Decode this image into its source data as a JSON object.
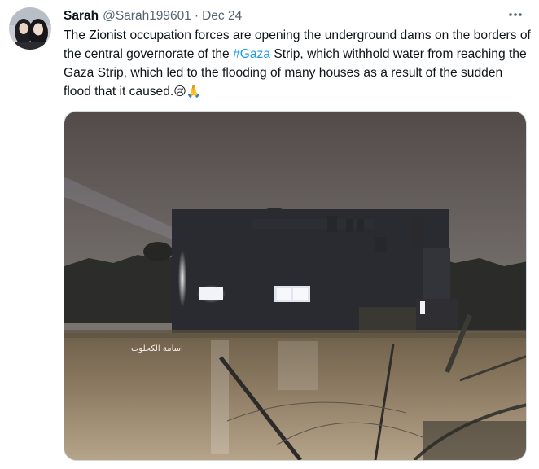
{
  "tweet": {
    "author_name": "Sarah",
    "author_handle": "@Sarah199601",
    "separator": "·",
    "date": "Dec 24",
    "more_glyph": "•••",
    "text_part1": "The Zionist occupation forces are opening the underground dams on the borders of the central governorate of the ",
    "hashtag": "#Gaza",
    "text_part2": " Strip, which withhold water from reaching the Gaza Strip, which led to the flooding of many houses as a result of the sudden flood that it caused.",
    "emoji1": "😢",
    "emoji2": "🙏"
  },
  "media": {
    "watermark": "اسامة الكحلوت"
  },
  "colors": {
    "text": "#0f1419",
    "secondary": "#536471",
    "link": "#1d9bf0",
    "border": "#cfd9de"
  },
  "icons": {
    "more": "more-horizontal-icon",
    "avatar": "avatar-image"
  }
}
